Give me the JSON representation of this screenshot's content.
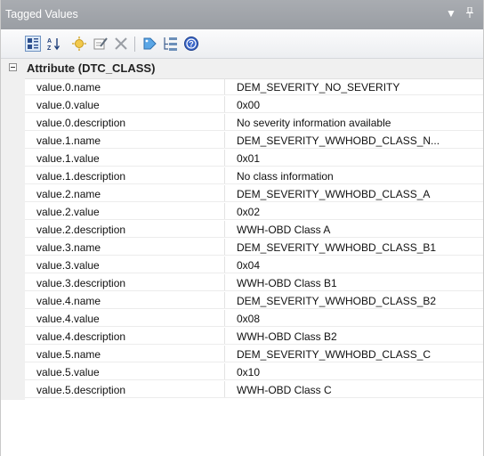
{
  "panel": {
    "title": "Tagged Values",
    "dropdown_glyph": "▼",
    "pin_glyph": "ꟸ"
  },
  "toolbar": {
    "icons": [
      "categorized-view-icon",
      "sort-alphabetical-icon",
      "new-tag-icon",
      "edit-tag-icon",
      "delete-tag-icon",
      "tag-filter-icon",
      "show-inherited-icon",
      "help-icon"
    ]
  },
  "grid": {
    "category_label": "Attribute (DTC_CLASS)",
    "rows": [
      {
        "name": "value.0.name",
        "value": "DEM_SEVERITY_NO_SEVERITY"
      },
      {
        "name": "value.0.value",
        "value": "0x00"
      },
      {
        "name": "value.0.description",
        "value": "No severity information available"
      },
      {
        "name": "value.1.name",
        "value": "DEM_SEVERITY_WWHOBD_CLASS_N..."
      },
      {
        "name": "value.1.value",
        "value": "0x01"
      },
      {
        "name": "value.1.description",
        "value": "No class information"
      },
      {
        "name": "value.2.name",
        "value": "DEM_SEVERITY_WWHOBD_CLASS_A"
      },
      {
        "name": "value.2.value",
        "value": "0x02"
      },
      {
        "name": "value.2.description",
        "value": "WWH-OBD Class A"
      },
      {
        "name": "value.3.name",
        "value": "DEM_SEVERITY_WWHOBD_CLASS_B1"
      },
      {
        "name": "value.3.value",
        "value": "0x04"
      },
      {
        "name": "value.3.description",
        "value": "WWH-OBD Class B1"
      },
      {
        "name": "value.4.name",
        "value": "DEM_SEVERITY_WWHOBD_CLASS_B2"
      },
      {
        "name": "value.4.value",
        "value": "0x08"
      },
      {
        "name": "value.4.description",
        "value": "WWH-OBD Class B2"
      },
      {
        "name": "value.5.name",
        "value": "DEM_SEVERITY_WWHOBD_CLASS_C"
      },
      {
        "name": "value.5.value",
        "value": "0x10"
      },
      {
        "name": "value.5.description",
        "value": "WWH-OBD Class C"
      }
    ]
  }
}
